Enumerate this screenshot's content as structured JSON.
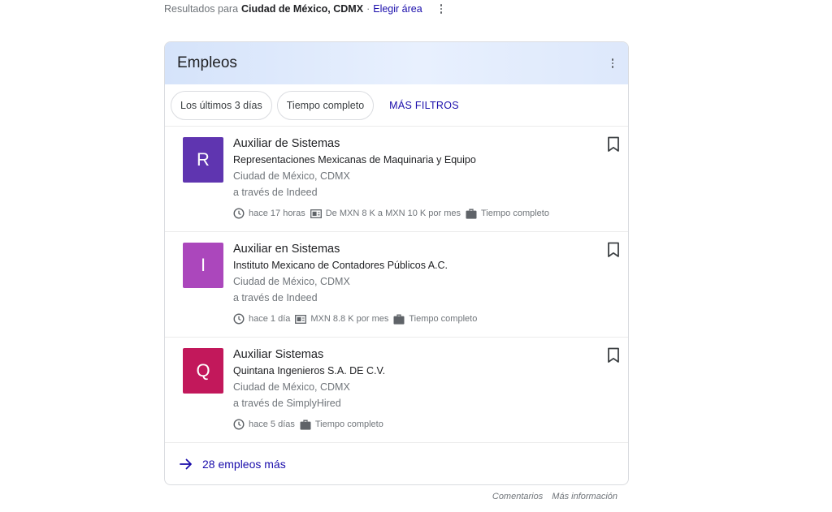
{
  "results": {
    "prefix": "Resultados para",
    "location": "Ciudad de México, CDMX",
    "separator": "·",
    "change_area": "Elegir área"
  },
  "card": {
    "title": "Empleos",
    "filters": [
      "Los últimos 3 días",
      "Tiempo completo"
    ],
    "more_filters": "MÁS FILTROS",
    "jobs": [
      {
        "logo_letter": "R",
        "logo_color": "#5f35b0",
        "title": "Auxiliar de Sistemas",
        "company": "Representaciones Mexicanas de Maquinaria y Equipo",
        "location": "Ciudad de México, CDMX",
        "via": "a través de Indeed",
        "posted": "hace 17 horas",
        "salary": "De MXN 8 K a MXN 10 K por mes",
        "type": "Tiempo completo"
      },
      {
        "logo_letter": "I",
        "logo_color": "#ab47bc",
        "title": "Auxiliar en Sistemas",
        "company": "Instituto Mexicano de Contadores Públicos A.C.",
        "location": "Ciudad de México, CDMX",
        "via": "a través de Indeed",
        "posted": "hace 1 día",
        "salary": "MXN 8.8 K por mes",
        "type": "Tiempo completo"
      },
      {
        "logo_letter": "Q",
        "logo_color": "#c2185b",
        "title": "Auxiliar Sistemas",
        "company": "Quintana Ingenieros S.A. DE C.V.",
        "location": "Ciudad de México, CDMX",
        "via": "a través de SimplyHired",
        "posted": "hace 5 días",
        "type": "Tiempo completo"
      }
    ],
    "more_jobs": "28 empleos más"
  },
  "footer": {
    "feedback": "Comentarios",
    "more_info": "Más información"
  },
  "colors": {
    "link": "#1a0dab",
    "header_bg": "#e8f0fe",
    "secondary_text": "#70757a"
  }
}
